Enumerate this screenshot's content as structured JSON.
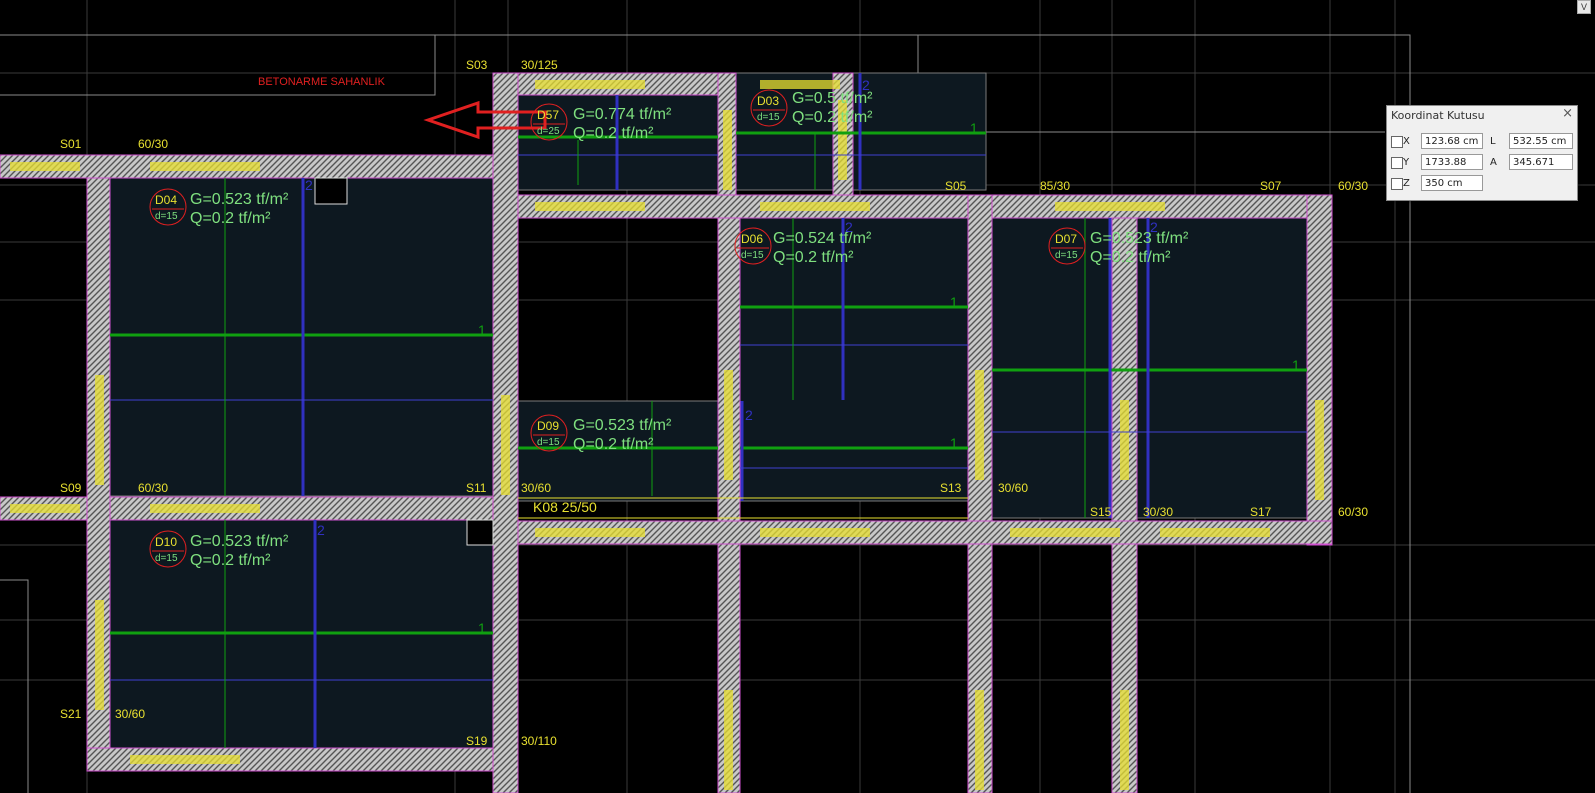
{
  "drawing": {
    "annotation_title": "BETONARME SAHANLIK",
    "column_labels": {
      "s01": "S01",
      "s03": "S03",
      "s05": "S05",
      "s07": "S07",
      "s09": "S09",
      "s11": "S11",
      "s13": "S13",
      "s15": "S15",
      "s17": "S17",
      "s19": "S19",
      "s21": "S21"
    },
    "dimensions": {
      "d1": "60/30",
      "d2": "30/125",
      "d3": "85/30",
      "d4": "60/30",
      "d5": "60/30",
      "d6": "30/60",
      "d7": "30/60",
      "d8": "30/30",
      "d9": "60/30",
      "d10": "30/60",
      "d11": "30/110"
    },
    "slabs": [
      {
        "id": "D04",
        "thickness": "d=15",
        "G": "G=0.523 tf/m²",
        "Q": "Q=0.2 tf/m²"
      },
      {
        "id": "D57",
        "thickness": "d=25",
        "G": "G=0.774 tf/m²",
        "Q": "Q=0.2 tf/m²"
      },
      {
        "id": "D03",
        "thickness": "d=15",
        "G": "G=0.5 tf/m²",
        "Q": "Q=0.2 tf/m²"
      },
      {
        "id": "D06",
        "thickness": "d=15",
        "G": "G=0.524 tf/m²",
        "Q": "Q=0.2 tf/m²"
      },
      {
        "id": "D07",
        "thickness": "d=15",
        "G": "G=0.523 tf/m²",
        "Q": "Q=0.2 tf/m²"
      },
      {
        "id": "D09",
        "thickness": "d=15",
        "G": "G=0.523 tf/m²",
        "Q": "Q=0.2 tf/m²"
      },
      {
        "id": "D10",
        "thickness": "d=15",
        "G": "G=0.523 tf/m²",
        "Q": "Q=0.2 tf/m²"
      }
    ],
    "beam_label": "K08 25/50",
    "axis_marks": {
      "one": "1",
      "two": "2"
    }
  },
  "coordinate_box": {
    "title": "Koordinat Kutusu",
    "close": "×",
    "x_label": "X",
    "x_value": "123.68 cm",
    "y_label": "Y",
    "y_value": "1733.88 cm",
    "z_label": "Z",
    "z_value": "350 cm",
    "l_label": "L",
    "l_value": "532.55 cm",
    "a_label": "A",
    "a_value": "345.671"
  },
  "corner_button": "V",
  "colors": {
    "background": "#000000",
    "slab_fill": "#0d1820",
    "beam_hatch": "#cfcfcf",
    "label_yellow": "#e8e030",
    "load_green": "#7fe07f",
    "outline_magenta": "#d050d0",
    "annotation_red": "#e02020",
    "axis_blue": "#3030c0",
    "rebar_green": "#10a010"
  }
}
